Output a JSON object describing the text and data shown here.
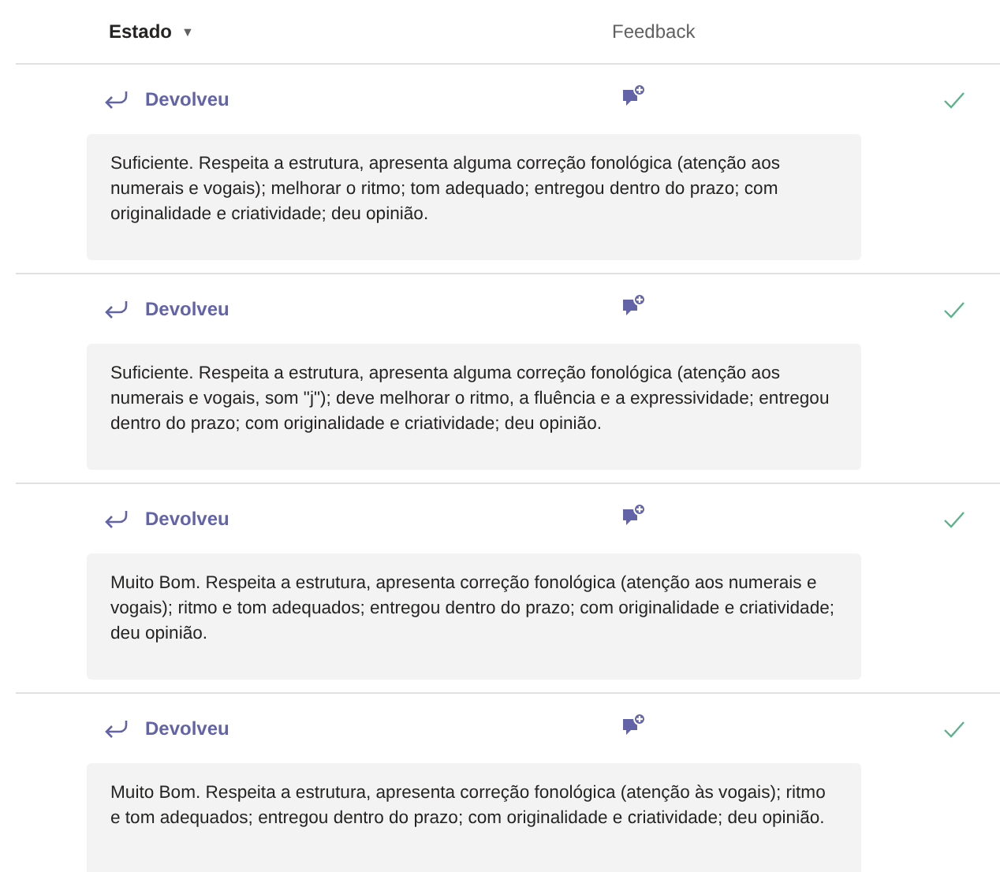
{
  "header": {
    "status_column": "Estado",
    "status_sort_glyph": "▼",
    "feedback_column": "Feedback"
  },
  "rows": [
    {
      "status": "Devolveu",
      "checked": true,
      "feedback": "Suficiente. Respeita a estrutura, apresenta alguma correção fonológica (atenção aos numerais e vogais); melhorar o ritmo; tom adequado; entregou dentro do prazo; com originalidade e criatividade; deu opinião."
    },
    {
      "status": "Devolveu",
      "checked": true,
      "feedback": "Suficiente. Respeita a estrutura, apresenta alguma correção fonológica (atenção aos numerais e vogais, som \"j\"); deve melhorar o ritmo, a fluência e a expressividade; entregou dentro do prazo; com originalidade e criatividade; deu opinião."
    },
    {
      "status": "Devolveu",
      "checked": true,
      "feedback": "Muito Bom. Respeita a estrutura, apresenta correção fonológica (atenção aos numerais e vogais); ritmo e tom adequados; entregou dentro do prazo; com originalidade e criatividade; deu opinião."
    },
    {
      "status": "Devolveu",
      "checked": true,
      "feedback": "Muito Bom. Respeita a estrutura, apresenta correção fonológica (atenção às vogais); ritmo e tom adequados; entregou dentro do prazo; com originalidade e criatividade; deu opinião."
    }
  ]
}
